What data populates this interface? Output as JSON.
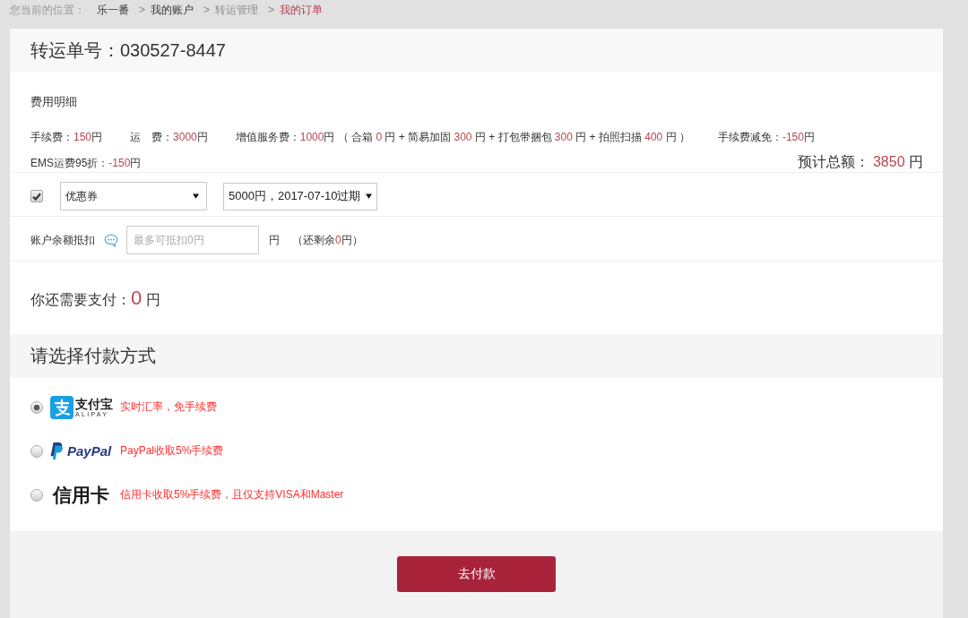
{
  "breadcrumb": {
    "label": "您当前的位置：",
    "items": [
      {
        "kind": "link",
        "text": "乐一番"
      },
      {
        "kind": "separator",
        "text": ">"
      },
      {
        "kind": "link",
        "text": "我的账户"
      },
      {
        "kind": "separator",
        "text": ">"
      },
      {
        "kind": "plain",
        "text": "转运管理"
      },
      {
        "kind": "separator",
        "text": ">"
      },
      {
        "kind": "current",
        "text": "我的订单"
      }
    ]
  },
  "header": {
    "title": "转运单号：030527-8447"
  },
  "fees": {
    "title": "费用明细",
    "items": [
      {
        "segments": [
          {
            "kind": "text",
            "text": "手续费："
          },
          {
            "kind": "amount",
            "text": "150"
          },
          {
            "kind": "text",
            "text": "円"
          }
        ]
      },
      {
        "segments": [
          {
            "kind": "text",
            "text": "运　费："
          },
          {
            "kind": "amount",
            "text": "3000"
          },
          {
            "kind": "text",
            "text": "円"
          }
        ]
      },
      {
        "segments": [
          {
            "kind": "text",
            "text": "增值服务费："
          },
          {
            "kind": "amount",
            "text": "1000"
          },
          {
            "kind": "text",
            "text": "円 （ 合箱 "
          },
          {
            "kind": "amount",
            "text": "0"
          },
          {
            "kind": "text",
            "text": " 円 + 简易加固 "
          },
          {
            "kind": "amount",
            "text": "300"
          },
          {
            "kind": "text",
            "text": " 円 + 打包带捆包 "
          },
          {
            "kind": "amount",
            "text": "300"
          },
          {
            "kind": "text",
            "text": " 円 + 拍照扫描 "
          },
          {
            "kind": "amount",
            "text": "400"
          },
          {
            "kind": "text",
            "text": " 円 ）"
          }
        ]
      },
      {
        "segments": [
          {
            "kind": "text",
            "text": "手续费减免："
          },
          {
            "kind": "amount",
            "text": "-150"
          },
          {
            "kind": "text",
            "text": "円"
          }
        ]
      },
      {
        "segments": [
          {
            "kind": "text",
            "text": "EMS运费95折："
          },
          {
            "kind": "amount",
            "text": "-150"
          },
          {
            "kind": "text",
            "text": "円"
          }
        ]
      }
    ],
    "total": [
      {
        "kind": "text",
        "text": "预计总额： "
      },
      {
        "kind": "amount",
        "text": "3850"
      },
      {
        "kind": "text",
        "text": " 円"
      }
    ]
  },
  "coupon": {
    "checked": true,
    "type_select": "优惠券",
    "coupon_select": "5000円，2017-07-10过期"
  },
  "balance": {
    "label": "账户余额抵扣",
    "placeholder": "最多可抵扣0円",
    "unit": "円",
    "remaining": [
      {
        "kind": "text",
        "text": "（还剩余"
      },
      {
        "kind": "amount",
        "text": "0"
      },
      {
        "kind": "text",
        "text": "円）"
      }
    ]
  },
  "due": [
    {
      "kind": "text",
      "text": "你还需要支付："
    },
    {
      "kind": "amount",
      "text": "0"
    },
    {
      "kind": "text",
      "text": " 円"
    }
  ],
  "payment": {
    "title": "请选择付款方式",
    "methods": [
      {
        "kind": "alipay",
        "selected": true,
        "logo_text": "支付宝",
        "logo_subtext": "ALIPAY",
        "note": "实时汇率，免手续费"
      },
      {
        "kind": "paypal",
        "selected": false,
        "logo_text": "PayPal",
        "note": "PayPal收取5%手续费"
      },
      {
        "kind": "card",
        "selected": false,
        "logo_text": "信用卡",
        "note": "信用卡收取5%手续费，且仅支持VISA和Master"
      }
    ]
  },
  "submit_button": "去付款"
}
